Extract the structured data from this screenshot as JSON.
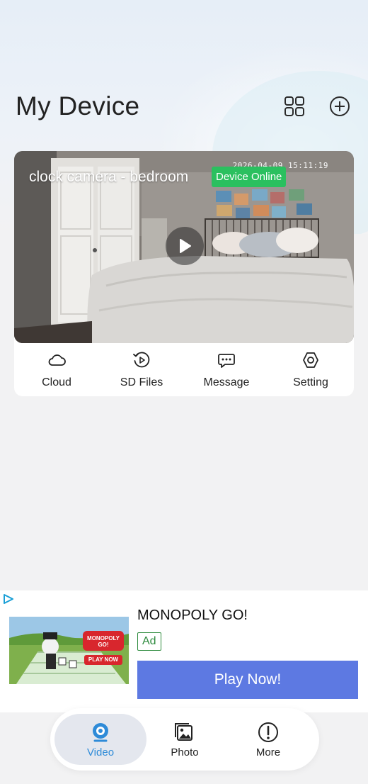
{
  "header": {
    "title": "My Device",
    "grid_icon": "grid-view-icon",
    "add_icon": "add-circle-icon"
  },
  "device": {
    "name": "clock camera - bedroom",
    "status": "Device Online",
    "timestamp": "2026-04-09  15:11:19",
    "status_color": "#2bc05f"
  },
  "actions": [
    {
      "label": "Cloud",
      "icon": "cloud-icon"
    },
    {
      "label": "SD Files",
      "icon": "sd-files-playback-icon"
    },
    {
      "label": "Message",
      "icon": "message-icon"
    },
    {
      "label": "Setting",
      "icon": "setting-hexagon-icon"
    }
  ],
  "ad": {
    "title": "MONOPOLY GO!",
    "badge": "Ad",
    "cta": "Play Now!",
    "image_logo_text": "MONOPOLY GO!",
    "image_button_text": "PLAY NOW",
    "cta_color": "#5d79e2"
  },
  "nav": {
    "items": [
      {
        "label": "Video",
        "icon": "webcam-icon",
        "active": true
      },
      {
        "label": "Photo",
        "icon": "photo-icon",
        "active": false
      },
      {
        "label": "More",
        "icon": "info-circle-icon",
        "active": false
      }
    ],
    "active_color": "#2e8bd8"
  }
}
